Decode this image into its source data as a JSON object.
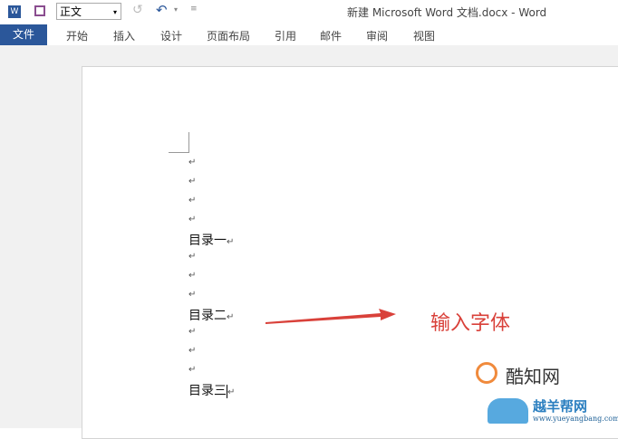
{
  "titlebar": {
    "title": "新建 Microsoft Word 文档.docx - Word",
    "style_value": "正文"
  },
  "tabs": [
    "文件",
    "开始",
    "插入",
    "设计",
    "页面布局",
    "引用",
    "邮件",
    "审阅",
    "视图"
  ],
  "document": {
    "paragraph_mark": "↵",
    "lines": [
      "目录一",
      "目录二",
      "目录三"
    ]
  },
  "annotation": {
    "text": "输入字体",
    "color": "#d9413a"
  },
  "watermarks": {
    "a": "酷知网",
    "b": "越羊帮网",
    "c": "www.yueyangbang.com"
  }
}
